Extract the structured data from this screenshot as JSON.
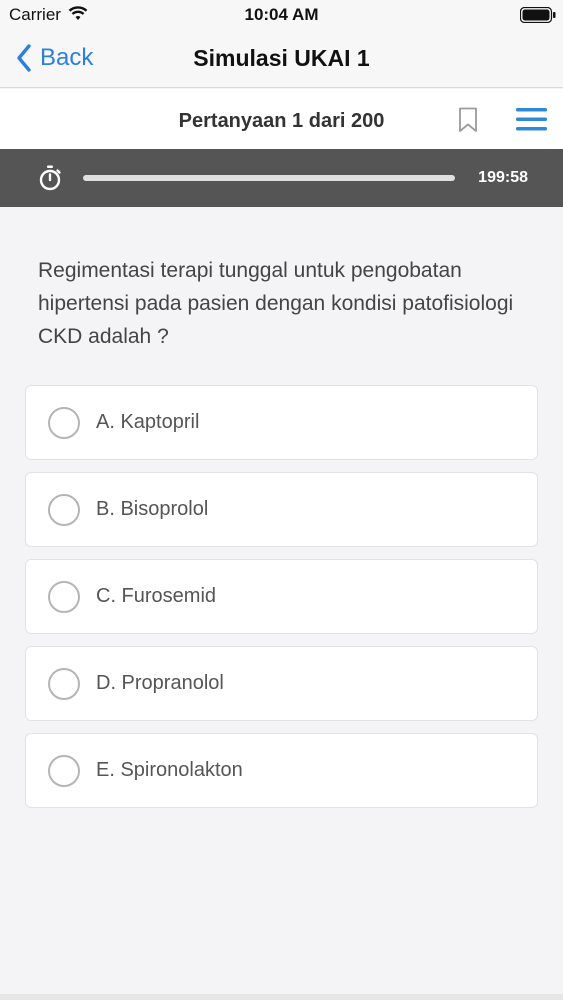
{
  "status_bar": {
    "carrier": "Carrier",
    "time": "10:04 AM",
    "icons": [
      "wifi-icon",
      "battery-icon"
    ]
  },
  "nav": {
    "back_label": "Back",
    "title": "Simulasi UKAI 1",
    "accent_color": "#2a7fe0"
  },
  "question_header": {
    "counter": "Pertanyaan 1 dari 200",
    "icons": [
      "bookmark-icon",
      "menu-icon"
    ],
    "menu_color": "#2e8ad6"
  },
  "timer": {
    "time_left": "199:58",
    "progress_fraction": 1.0,
    "icon": "stopwatch-icon"
  },
  "question": {
    "text": "Regimentasi terapi tunggal untuk pengobatan hipertensi pada pasien dengan kondisi patofisiologi CKD adalah ?"
  },
  "options": [
    {
      "label": "A. Kaptopril"
    },
    {
      "label": "B. Bisoprolol"
    },
    {
      "label": "C. Furosemid"
    },
    {
      "label": "D. Propranolol"
    },
    {
      "label": "E. Spironolakton"
    }
  ]
}
